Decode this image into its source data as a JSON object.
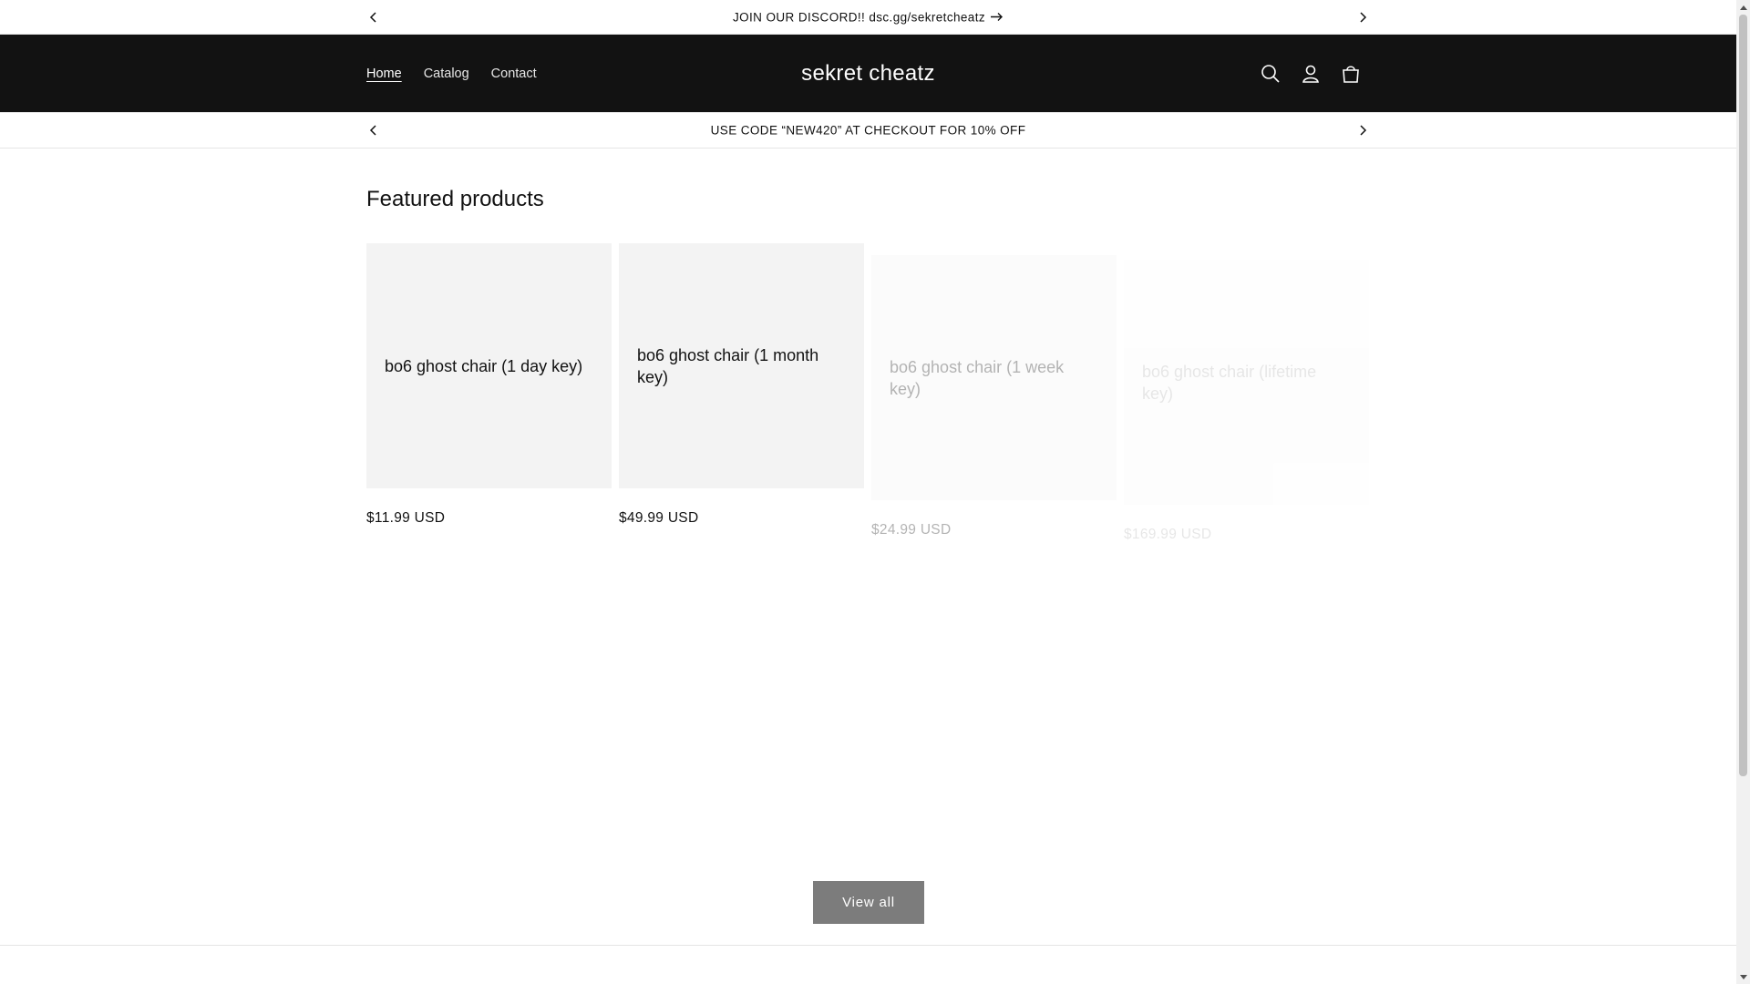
{
  "announcements": {
    "top": {
      "text": "JOIN OUR DISCORD!! dsc.gg/sekretcheatz",
      "icon": "arrow-right-icon"
    },
    "bottom": {
      "text": "USE CODE “NEW420” AT CHECKOUT FOR 10% OFF"
    }
  },
  "header": {
    "nav": [
      {
        "label": "Home",
        "active": true
      },
      {
        "label": "Catalog",
        "active": false
      },
      {
        "label": "Contact",
        "active": false
      }
    ],
    "logo": "sekret cheatz",
    "icons": [
      "search-icon",
      "account-icon",
      "cart-icon"
    ],
    "colors": {
      "background": "#121212",
      "text": "#ffffff"
    }
  },
  "featured": {
    "title": "Featured products",
    "products": [
      {
        "title": "bo6 ghost chair (1 day key)",
        "price": "$11.99 USD"
      },
      {
        "title": "bo6 ghost chair (1 month key)",
        "price": "$49.99 USD"
      },
      {
        "title": "bo6 ghost chair (1 week key)",
        "price": "$24.99 USD"
      },
      {
        "title": "bo6 ghost chair (lifetime key)",
        "price": "$169.99 USD"
      }
    ],
    "view_all_label": "View all"
  }
}
